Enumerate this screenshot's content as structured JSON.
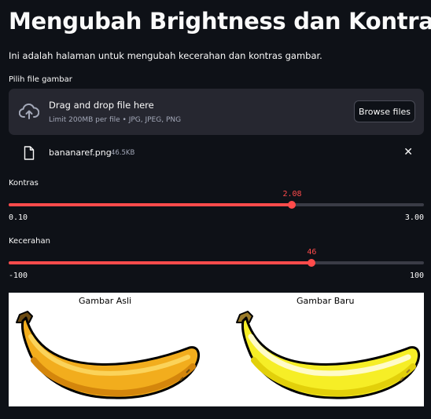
{
  "page": {
    "title": "Mengubah Brightness dan Kontras",
    "subtitle": "Ini adalah halaman untuk mengubah kecerahan dan kontras gambar."
  },
  "uploader": {
    "label": "Pilih file gambar",
    "drag_text": "Drag and drop file here",
    "limit_text": "Limit 200MB per file • JPG, JPEG, PNG",
    "browse_label": "Browse files",
    "icon": "cloud-upload-icon"
  },
  "uploaded_file": {
    "name": "bananaref.png",
    "size": "46.5KB",
    "icon": "file-icon",
    "remove_icon": "close-icon",
    "remove_glyph": "✕"
  },
  "sliders": {
    "contrast": {
      "label": "Kontras",
      "value": 2.08,
      "value_text": "2.08",
      "min": 0.1,
      "max": 3.0,
      "min_text": "0.10",
      "max_text": "3.00"
    },
    "brightness": {
      "label": "Kecerahan",
      "value": 46,
      "value_text": "46",
      "min": -100,
      "max": 100,
      "min_text": "-100",
      "max_text": "100"
    }
  },
  "figure": {
    "left_caption": "Gambar Asli",
    "right_caption": "Gambar Baru"
  },
  "colors": {
    "accent": "#ff4b4b",
    "background": "#0e1117",
    "panel": "#262730"
  }
}
